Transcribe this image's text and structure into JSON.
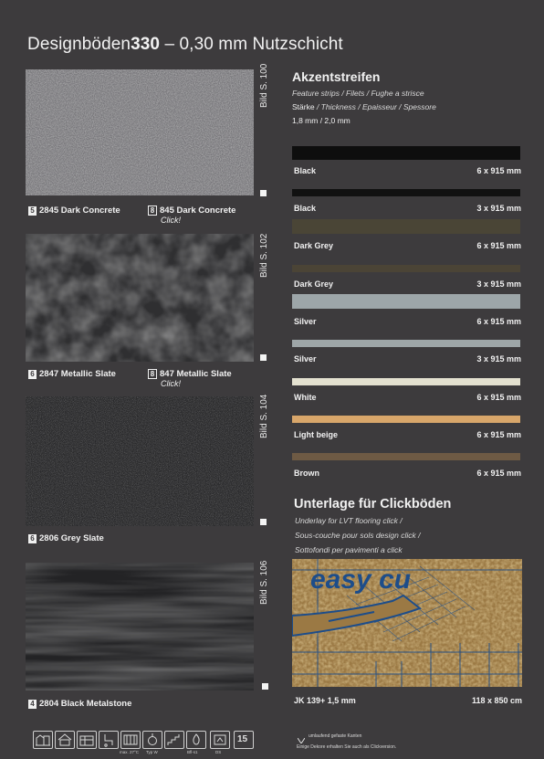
{
  "header": {
    "title_prefix": "Designböden",
    "title_number": "330",
    "title_suffix": " – 0,30 mm Nutzschicht"
  },
  "swatches": [
    {
      "bild": "Bild S. 100",
      "badge": "5",
      "name": "2845 Dark Concrete",
      "badge2": "8",
      "name2": "845 Dark Concrete",
      "sub2": "Click!"
    },
    {
      "bild": "Bild S. 102",
      "badge": "6",
      "name": "2847 Metallic Slate",
      "badge2": "8",
      "name2": "847 Metallic Slate",
      "sub2": "Click!"
    },
    {
      "bild": "Bild S. 104",
      "badge": "6",
      "name": "2806 Grey Slate"
    },
    {
      "bild": "Bild S. 106",
      "badge": "4",
      "name": "2804 Black Metalstone"
    }
  ],
  "accent": {
    "title": "Akzentstreifen",
    "translations": "Feature strips / Filets / Fughe a strisce",
    "thickness_label_bold": "Stärke",
    "thickness_label_rest": " / Thickness / Epaisseur / Spessore",
    "thickness_values": "1,8 mm / 2,0 mm",
    "strips": [
      {
        "name": "Black",
        "size": "6 x 915 mm",
        "color": "#0e0e0e"
      },
      {
        "name": "Black",
        "size": "3 x 915 mm",
        "color": "#111111"
      },
      {
        "name": "Dark Grey",
        "size": "6 x 915 mm",
        "color": "#4a4536"
      },
      {
        "name": "Dark Grey",
        "size": "3 x 915 mm",
        "color": "#4b4436"
      },
      {
        "name": "Silver",
        "size": "6 x 915 mm",
        "color": "#9da6a9"
      },
      {
        "name": "Silver",
        "size": "3 x 915 mm",
        "color": "#9ea6a8"
      },
      {
        "name": "White",
        "size": "6 x 915 mm",
        "color": "#e4e1d0"
      },
      {
        "name": "Light beige",
        "size": "6 x 915 mm",
        "color": "#d8a66a"
      },
      {
        "name": "Brown",
        "size": "6 x 915 mm",
        "color": "#6e5a44"
      }
    ]
  },
  "underlay": {
    "title": "Unterlage für Clickböden",
    "lines": [
      "Underlay for LVT flooring click /",
      "Sous-couche pour sols design click /",
      "Sottofondi per pavimenti a click"
    ],
    "photo_text": "easy cu",
    "caption": "JK 139+ 1,5 mm",
    "size": "118 x 850 cm"
  },
  "footer": {
    "icons": [
      "building-icon",
      "home-icon",
      "heating-icon",
      "chair-castor-icon",
      "stairs-icon",
      "fire-icon",
      "emission-icon",
      "warranty-icon"
    ],
    "icon_labels": [
      "max. 27°C",
      "Typ W",
      "Bfl-s1",
      "DS",
      "15"
    ],
    "note1": "umlaufend gefaste Kanten",
    "note2": "Einige Dekore erhalten Sie auch als Clickversion."
  }
}
